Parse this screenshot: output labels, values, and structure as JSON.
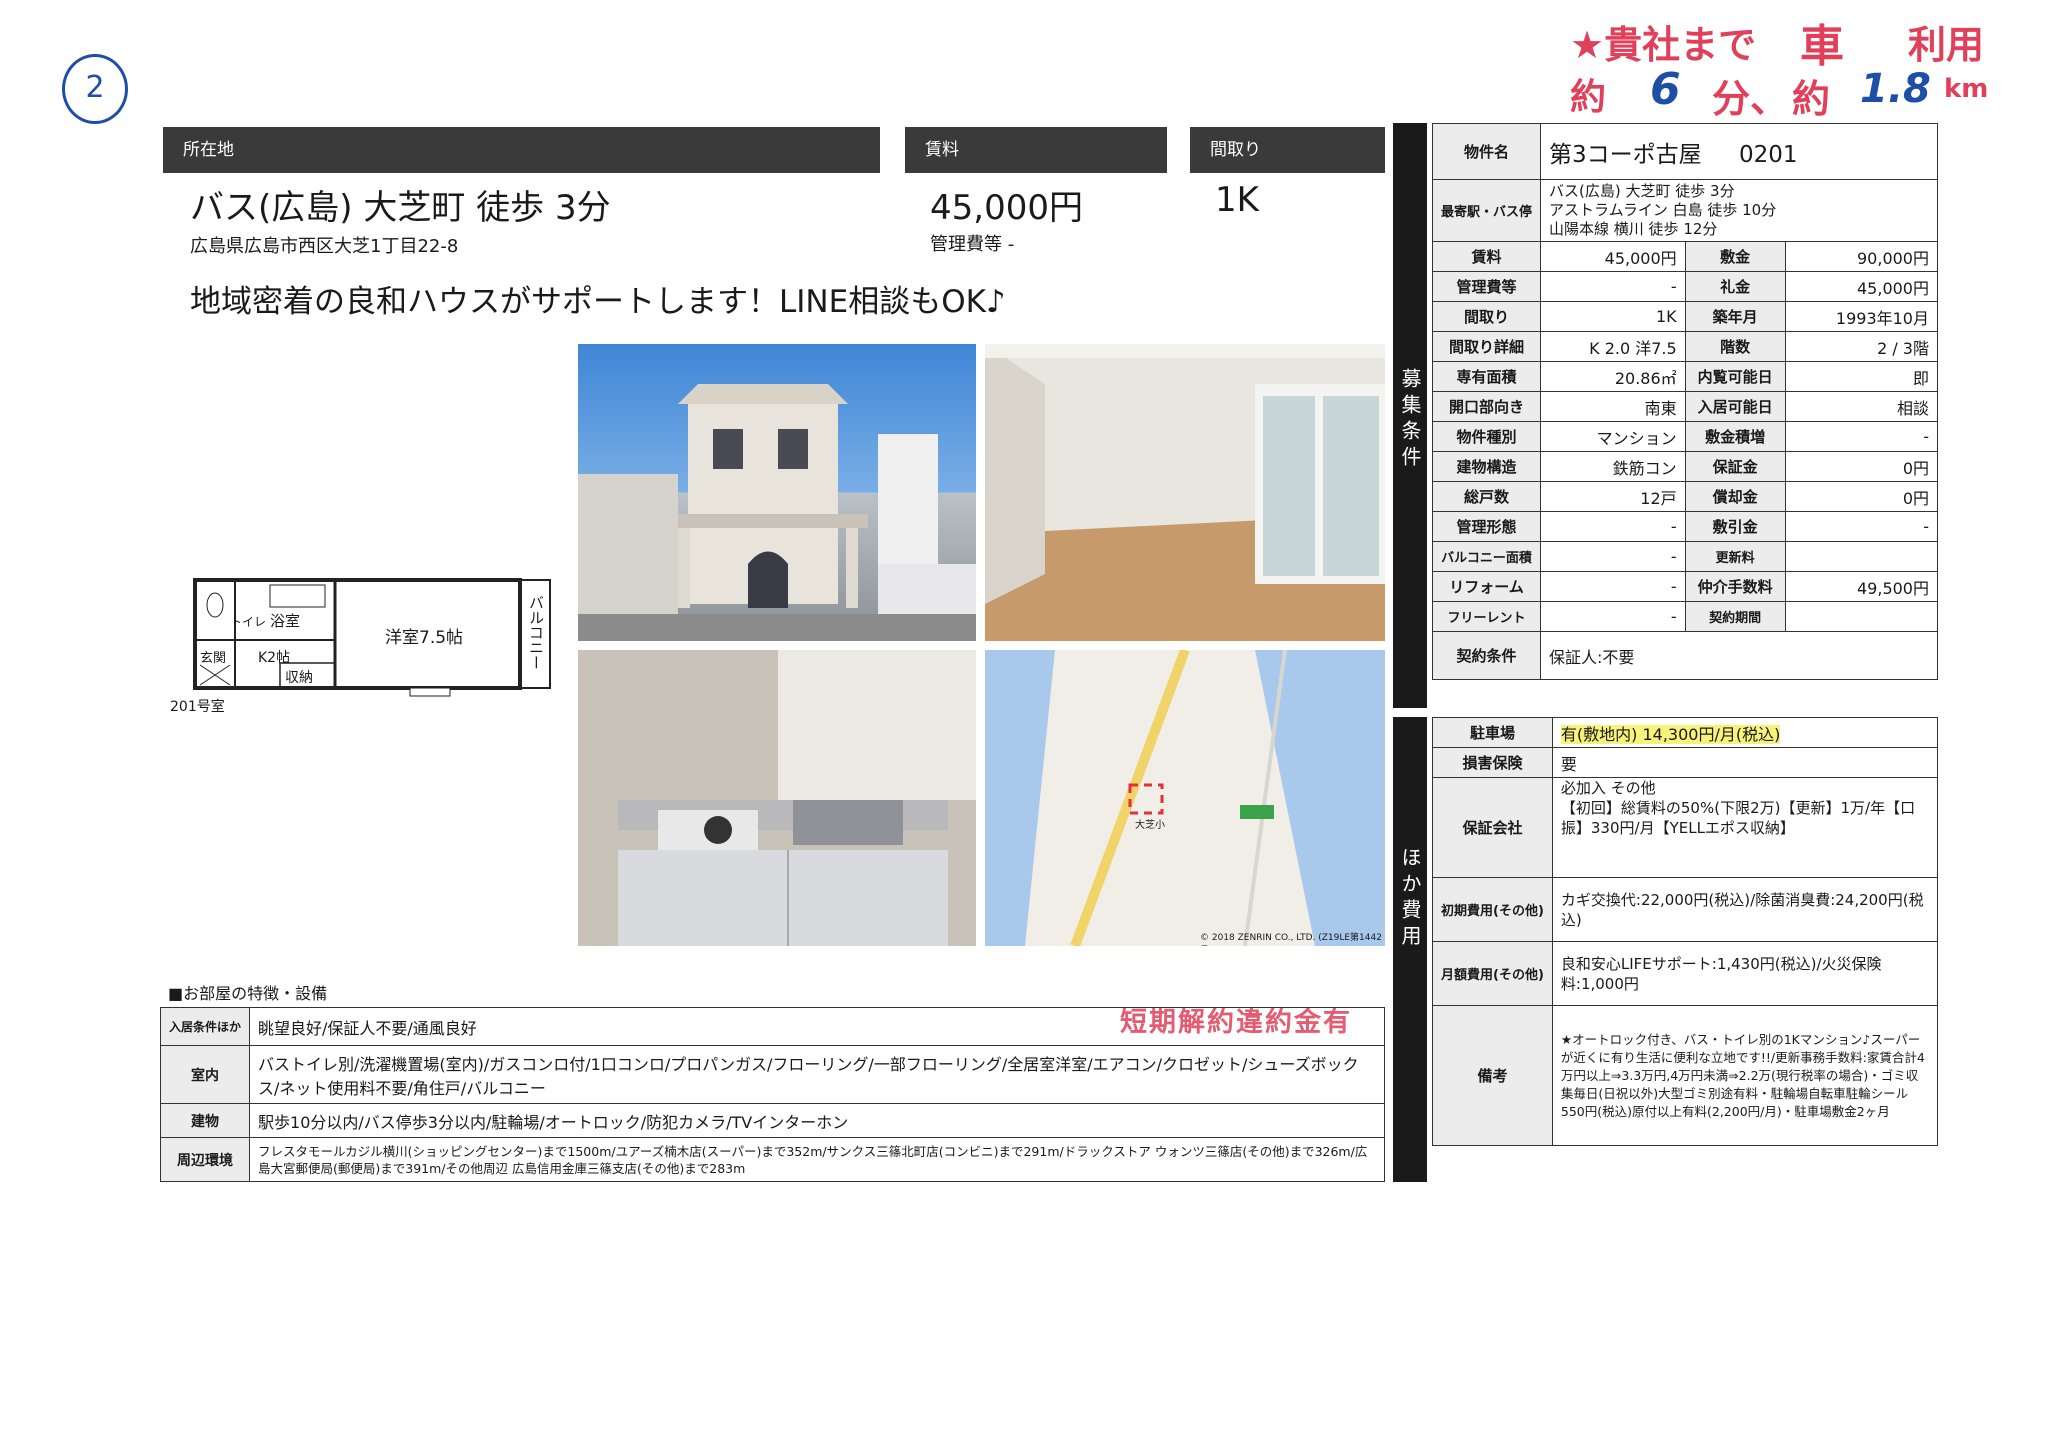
{
  "page_number": "2",
  "handwritten": {
    "line1": "★貴社まで",
    "mode": "車",
    "use": "利用",
    "approx1": "約",
    "minutes": "6",
    "min_unit": "分、",
    "approx2": "約",
    "distance": "1.8",
    "dist_unit": "km"
  },
  "header": {
    "location_label": "所在地",
    "rent_label": "賃料",
    "layout_label": "間取り"
  },
  "summary": {
    "access": "バス(広島) 大芝町 徒歩 3分",
    "address": "広島県広島市西区大芝1丁目22-8",
    "rent": "45,000円",
    "mgmt_fee": "管理費等 -",
    "layout": "1K",
    "catchphrase": "地域密着の良和ハウスがサポートします！LINE相談もOK♪"
  },
  "floorplan": {
    "toilet": "トイレ",
    "bath": "浴室",
    "room": "洋室7.5帖",
    "balcony": "バルコニー",
    "entrance": "玄関",
    "kitchen": "K2帖",
    "storage": "収納",
    "room_no": "201号室"
  },
  "map_credit": "© 2018 ZENRIN CO., LTD. (Z19LE第1442号)",
  "map_label": "大芝小",
  "features": {
    "title": "■お部屋の特徴・設備",
    "stamp": "短期解約違約金有",
    "rows": [
      {
        "label": "入居条件ほか",
        "text": "眺望良好/保証人不要/通風良好"
      },
      {
        "label": "室内",
        "text": "バストイレ別/洗濯機置場(室内)/ガスコンロ付/1口コンロ/プロパンガス/フローリング/一部フローリング/全居室洋室/エアコン/クロゼット/シューズボックス/ネット使用料不要/角住戸/バルコニー"
      },
      {
        "label": "建物",
        "text": "駅歩10分以内/バス停歩3分以内/駐輪場/オートロック/防犯カメラ/TVインターホン"
      },
      {
        "label": "周辺環境",
        "text": "フレスタモールカジル横川(ショッピングセンター)まで1500m/ユアーズ楠木店(スーパー)まで352m/サンクス三篠北町店(コンビニ)まで291m/ドラックストア ウォンツ三篠店(その他)まで326m/広島大宮郵便局(郵便局)まで391m/その他周辺 広島信用金庫三篠支店(その他)まで283m"
      }
    ]
  },
  "side_labels": {
    "recruit": "募集条件",
    "other": "ほか費用"
  },
  "property": {
    "name_label": "物件名",
    "name": "第3コーポ古屋",
    "room": "0201",
    "station_label": "最寄駅・バス停",
    "stations": [
      "バス(広島) 大芝町 徒歩 3分",
      "アストラムライン 白島 徒歩 10分",
      "山陽本線 横川 徒歩 12分"
    ],
    "pairs": [
      {
        "l1": "賃料",
        "v1": "45,000円",
        "l2": "敷金",
        "v2": "90,000円"
      },
      {
        "l1": "管理費等",
        "v1": "-",
        "l2": "礼金",
        "v2": "45,000円"
      },
      {
        "l1": "間取り",
        "v1": "1K",
        "l2": "築年月",
        "v2": "1993年10月"
      },
      {
        "l1": "間取り詳細",
        "v1": "K 2.0 洋7.5",
        "l2": "階数",
        "v2": "2 / 3階"
      },
      {
        "l1": "専有面積",
        "v1": "20.86㎡",
        "l2": "内覧可能日",
        "v2": "即"
      },
      {
        "l1": "開口部向き",
        "v1": "南東",
        "l2": "入居可能日",
        "v2": "相談"
      },
      {
        "l1": "物件種別",
        "v1": "マンション",
        "l2": "敷金積増",
        "v2": "-"
      },
      {
        "l1": "建物構造",
        "v1": "鉄筋コン",
        "l2": "保証金",
        "v2": "0円"
      },
      {
        "l1": "総戸数",
        "v1": "12戸",
        "l2": "償却金",
        "v2": "0円"
      },
      {
        "l1": "管理形態",
        "v1": "-",
        "l2": "敷引金",
        "v2": "-"
      },
      {
        "l1": "バルコニー面積",
        "v1": "-",
        "l2": "更新料",
        "v2": ""
      },
      {
        "l1": "リフォーム",
        "v1": "-",
        "l2": "仲介手数料",
        "v2": "49,500円"
      },
      {
        "l1": "フリーレント",
        "v1": "-",
        "l2": "契約期間",
        "v2": ""
      }
    ],
    "contract_label": "契約条件",
    "contract": "保証人:不要"
  },
  "costs": {
    "parking_label": "駐車場",
    "parking": "有(敷地内) 14,300円/月(税込)",
    "insurance_label": "損害保険",
    "insurance": "要",
    "guarantor_label": "保証会社",
    "guarantor": "必加入 その他\n【初回】総賃料の50%(下限2万)【更新】1万/年【口振】330円/月【YELLエポス収納】",
    "initial_label": "初期費用(その他)",
    "initial": "カギ交換代:22,000円(税込)/除菌消臭費:24,200円(税込)",
    "monthly_label": "月額費用(その他)",
    "monthly": "良和安心LIFEサポート:1,430円(税込)/火災保険料:1,000円",
    "remarks_label": "備考",
    "remarks": "★オートロック付き、バス・トイレ別の1Kマンション♪スーパーが近くに有り生活に便利な立地です!!/更新事務手数料:家賃合計4万円以上⇒3.3万円,4万円未満⇒2.2万(現行税率の場合)・ゴミ収集毎日(日祝以外)大型ゴミ別途有料・駐輪場自転車駐輪シール550円(税込)原付以上有料(2,200円/月)・駐車場敷金2ヶ月"
  },
  "colors": {
    "header_bg": "#3a3a3a",
    "stamp": "#e0405a",
    "highlight": "#f6f27a",
    "pen": "#1d4fa8"
  }
}
